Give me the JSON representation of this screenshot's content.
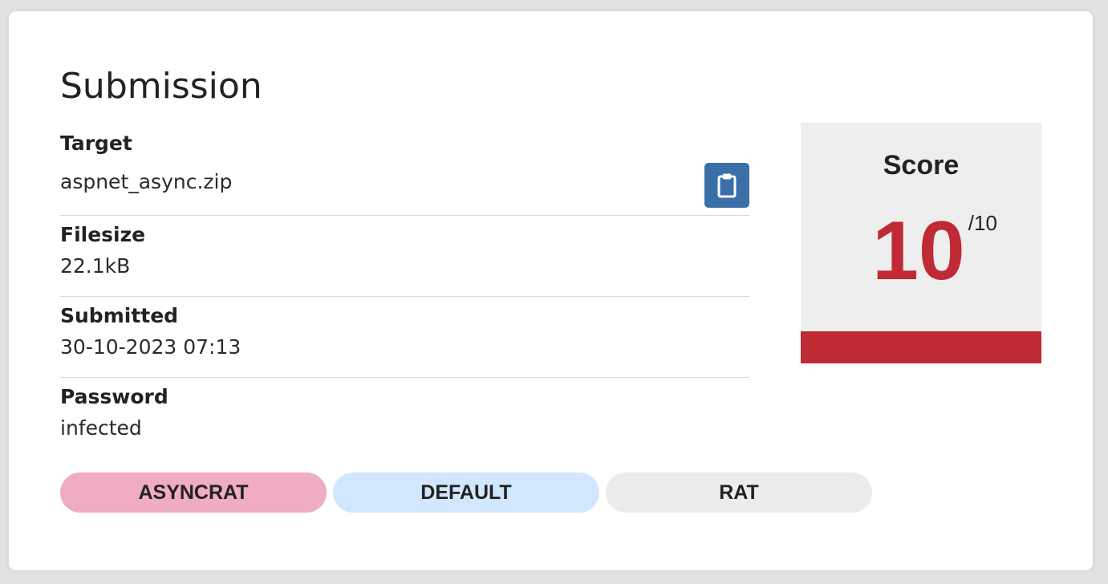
{
  "submission": {
    "title": "Submission",
    "fields": {
      "target": {
        "label": "Target",
        "value": "aspnet_async.zip"
      },
      "filesize": {
        "label": "Filesize",
        "value": "22.1kB"
      },
      "submitted": {
        "label": "Submitted",
        "value": "30-10-2023 07:13"
      },
      "password": {
        "label": "Password",
        "value": "infected"
      }
    },
    "copy_icon": "clipboard-icon",
    "tags": [
      {
        "label": "ASYNCRAT",
        "color": "#efacc2"
      },
      {
        "label": "DEFAULT",
        "color": "#d0e7fd"
      },
      {
        "label": "RAT",
        "color": "#ececec"
      }
    ]
  },
  "score": {
    "title": "Score",
    "value": "10",
    "max": "/10",
    "fraction": 1.0,
    "color": "#bf2a34",
    "panel_color": "#eeeeee"
  },
  "colors": {
    "accent": "#3b6fa8"
  }
}
